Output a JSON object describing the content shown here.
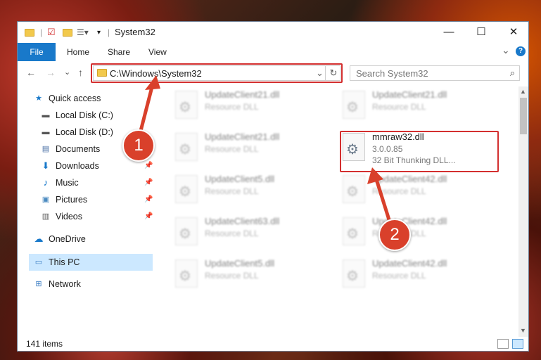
{
  "window": {
    "title": "System32",
    "accent": "#1979ca",
    "min_symbol": "—",
    "max_symbol": "☐",
    "close_symbol": "✕"
  },
  "ribbon": {
    "file_label": "File",
    "tabs": [
      "Home",
      "Share",
      "View"
    ],
    "expand_symbol": "⌄",
    "help_symbol": "?"
  },
  "address": {
    "path": "C:\\Windows\\System32",
    "dropdown_symbol": "⌄",
    "refresh_symbol": "↻",
    "back_symbol": "←",
    "forward_symbol": "→",
    "recent_symbol": "⌄",
    "up_symbol": "↑"
  },
  "search": {
    "placeholder": "Search System32",
    "icon": "search-icon"
  },
  "sidebar": {
    "items": [
      {
        "label": "Quick access",
        "icon": "star-icon"
      },
      {
        "label": "Local Disk (C:)",
        "icon": "drive-icon"
      },
      {
        "label": "Local Disk (D:)",
        "icon": "drive-icon"
      },
      {
        "label": "Documents",
        "icon": "documents-icon"
      },
      {
        "label": "Downloads",
        "icon": "downloads-icon"
      },
      {
        "label": "Music",
        "icon": "music-icon"
      },
      {
        "label": "Pictures",
        "icon": "pictures-icon"
      },
      {
        "label": "Videos",
        "icon": "videos-icon"
      },
      {
        "label": "OneDrive",
        "icon": "cloud-icon"
      },
      {
        "label": "This PC",
        "icon": "computer-icon"
      },
      {
        "label": "Network",
        "icon": "network-icon"
      }
    ]
  },
  "files": {
    "col1": [
      {
        "name": "UpdateClient21.dll",
        "desc": "Resource DLL"
      },
      {
        "name": "UpdateClient21.dll",
        "desc": "Resource DLL"
      },
      {
        "name": "UpdateClient5.dll",
        "desc": "Resource DLL"
      },
      {
        "name": "UpdateClient63.dll",
        "desc": "Resource DLL"
      },
      {
        "name": "UpdateClient5.dll",
        "desc": "Resource DLL"
      }
    ],
    "col2": [
      {
        "name": "UpdateClient21.dll",
        "desc": "Resource DLL"
      },
      {
        "name": "UpdateClient42.dll",
        "desc": "Resource DLL"
      },
      {
        "name": "UpdateClient42.dll",
        "desc": "Resource DLL"
      },
      {
        "name": "UpdateClient42.dll",
        "desc": "Resource DLL"
      }
    ],
    "highlighted": {
      "name": "mmraw32.dll",
      "version": "3.0.0.85",
      "desc": "32 Bit Thunking DLL..."
    }
  },
  "annotations": {
    "step1": "1",
    "step2": "2",
    "color": "#d9402b"
  },
  "status": {
    "count": "141 items"
  }
}
